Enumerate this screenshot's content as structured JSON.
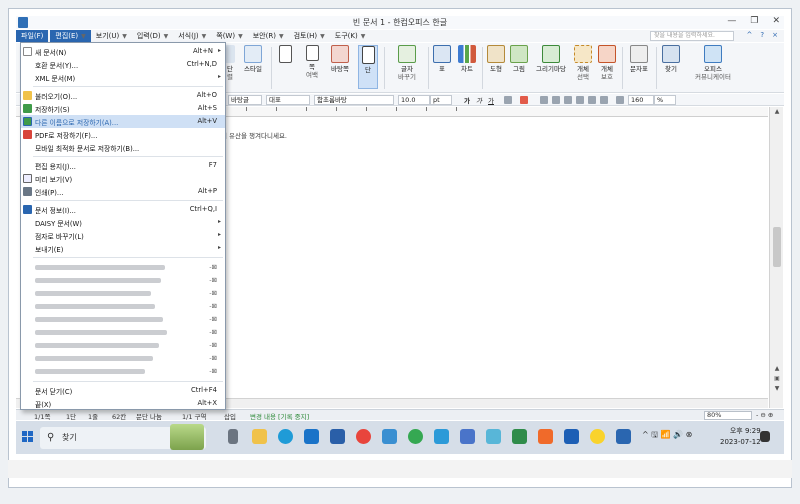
{
  "window": {
    "title": "빈 문서 1 - 한컴오피스 한글",
    "controls": [
      "—",
      "❐",
      "✕"
    ]
  },
  "menubar": {
    "items": [
      {
        "label": "파일(F)",
        "state": "open"
      },
      {
        "label": "편집(E)",
        "state": "highlighted"
      },
      {
        "label": "보기(U)"
      },
      {
        "label": "입력(D)"
      },
      {
        "label": "서식(J)"
      },
      {
        "label": "쪽(W)"
      },
      {
        "label": "보안(R)"
      },
      {
        "label": "검토(H)"
      },
      {
        "label": "도구(K)"
      }
    ],
    "search_placeholder": "찾을 내용을 입력하세요.",
    "right_buttons": [
      "^",
      "?",
      "×"
    ]
  },
  "ribbon": {
    "buttons": [
      {
        "label": "단",
        "sub": "렬"
      },
      {
        "label": "스타일",
        "sub": ""
      },
      {
        "label": "쪽",
        "sub": "여백"
      },
      {
        "label": "바탕쪽",
        "sub": ""
      },
      {
        "label": "단",
        "sub": ""
      },
      {
        "label": "글자",
        "sub": "바꾸기"
      },
      {
        "label": "표",
        "sub": ""
      },
      {
        "label": "차트",
        "sub": ""
      },
      {
        "label": "도형",
        "sub": ""
      },
      {
        "label": "그림",
        "sub": ""
      },
      {
        "label": "그리기마당",
        "sub": ""
      },
      {
        "label": "개체",
        "sub": "선택"
      },
      {
        "label": "개체",
        "sub": "보호"
      },
      {
        "label": "문자표",
        "sub": ""
      },
      {
        "label": "찾기",
        "sub": ""
      },
      {
        "label": "오피스",
        "sub": "커뮤니케이터"
      }
    ]
  },
  "format_bar": {
    "style": "바탕글",
    "lang": "대표",
    "font": "함초롬바탕",
    "size": "10.0",
    "unit": "pt",
    "zoom": "160",
    "zoom_unit": "%",
    "text_style_buttons": [
      "가",
      "가",
      "가"
    ]
  },
  "document": {
    "text": "니 유산을 챙겨다니세요."
  },
  "file_menu": {
    "items": [
      {
        "label": "새 문서(N)",
        "shortcut": "Alt+N",
        "arrow": true
      },
      {
        "label": "호환 문서(Y)...",
        "shortcut": "Ctrl+N,D"
      },
      {
        "label": "XML 문서(M)",
        "arrow": true
      },
      {
        "label": "불러오기(O)...",
        "shortcut": "Alt+O"
      },
      {
        "label": "저장하기(S)",
        "shortcut": "Alt+S"
      },
      {
        "label": "다른 이름으로 저장하기(A)...",
        "shortcut": "Alt+V",
        "highlighted": true
      },
      {
        "label": "PDF로 저장하기(F)..."
      },
      {
        "label": "모바일 최적화 문서로 저장하기(B)..."
      },
      {
        "label": "편집 용지(J)...",
        "shortcut": "F7"
      },
      {
        "label": "미리 보기(V)"
      },
      {
        "label": "인쇄(P)...",
        "shortcut": "Alt+P"
      },
      {
        "label": "문서 정보(I)...",
        "shortcut": "Ctrl+Q,I"
      },
      {
        "label": "DAISY 문서(W)",
        "arrow": true
      },
      {
        "label": "점자로 바꾸기(L)",
        "arrow": true
      },
      {
        "label": "보내기(E)",
        "arrow": true
      },
      {
        "label": "문서 닫기(C)",
        "shortcut": "Ctrl+F4"
      },
      {
        "label": "끝(X)",
        "shortcut": "Alt+X"
      }
    ],
    "recent_pin": "-⊠"
  },
  "statusbar": {
    "items": [
      "1/1쪽",
      "1단",
      "1줄",
      "62칸",
      "문단 나눔",
      "1/1 구역",
      "삽입",
      "변경 내용 [기록 중지]"
    ],
    "zoom": "80%",
    "zoom_controls": "- ⊖ ⊕"
  },
  "taskbar": {
    "search_label": "찾기",
    "clock_time": "오후 9:29",
    "clock_date": "2023-07-12",
    "tray": "^ 🖫 📶 🔊 ⊗"
  },
  "colors": {
    "accent": "#2a66b0",
    "highlight": "#cfe0f5",
    "status_green": "#2e8b3a"
  }
}
